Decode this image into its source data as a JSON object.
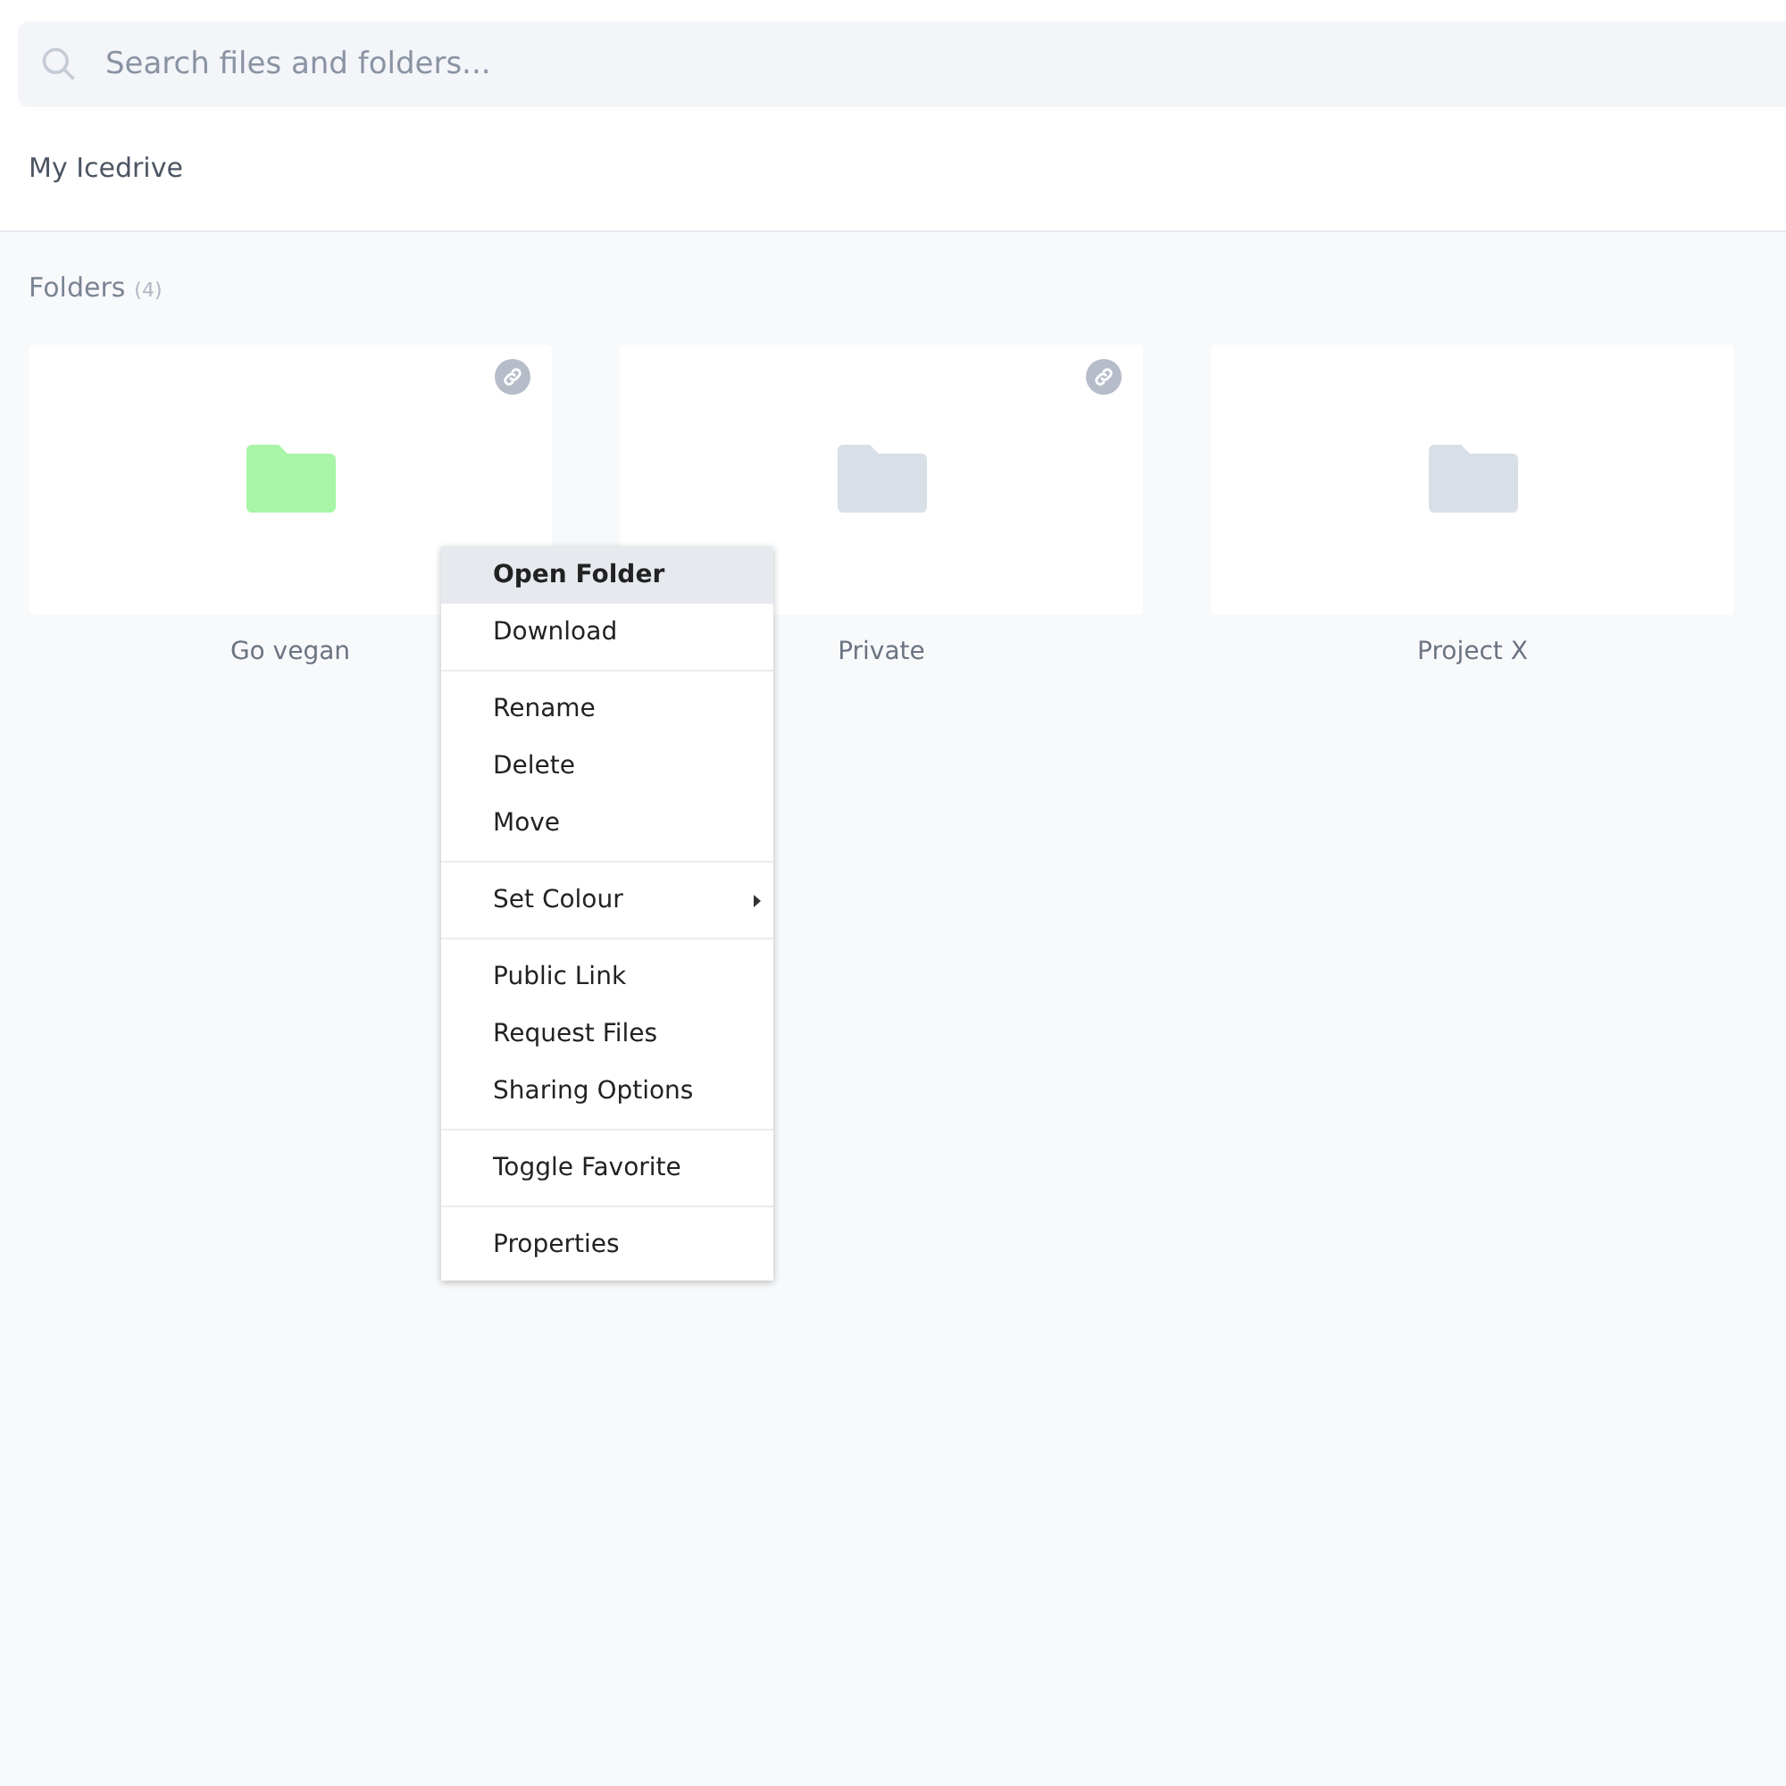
{
  "search": {
    "placeholder": "Search files and folders..."
  },
  "breadcrumb": "My Icedrive",
  "section": {
    "title": "Folders",
    "count": "(4)"
  },
  "folders": [
    {
      "name": "Go vegan",
      "color": "#a8f5a8",
      "linked": true
    },
    {
      "name": "Private",
      "color": "#d8dfe7",
      "linked": true
    },
    {
      "name": "Project X",
      "color": "#d8dfe7",
      "linked": false
    }
  ],
  "context_menu": {
    "groups": [
      [
        {
          "label": "Open Folder",
          "selected": true,
          "submenu": false
        },
        {
          "label": "Download",
          "selected": false,
          "submenu": false
        }
      ],
      [
        {
          "label": "Rename",
          "selected": false,
          "submenu": false
        },
        {
          "label": "Delete",
          "selected": false,
          "submenu": false
        },
        {
          "label": "Move",
          "selected": false,
          "submenu": false
        }
      ],
      [
        {
          "label": "Set Colour",
          "selected": false,
          "submenu": true
        }
      ],
      [
        {
          "label": "Public Link",
          "selected": false,
          "submenu": false
        },
        {
          "label": "Request Files",
          "selected": false,
          "submenu": false
        },
        {
          "label": "Sharing Options",
          "selected": false,
          "submenu": false
        }
      ],
      [
        {
          "label": "Toggle Favorite",
          "selected": false,
          "submenu": false
        }
      ],
      [
        {
          "label": "Properties",
          "selected": false,
          "submenu": false
        }
      ]
    ]
  }
}
